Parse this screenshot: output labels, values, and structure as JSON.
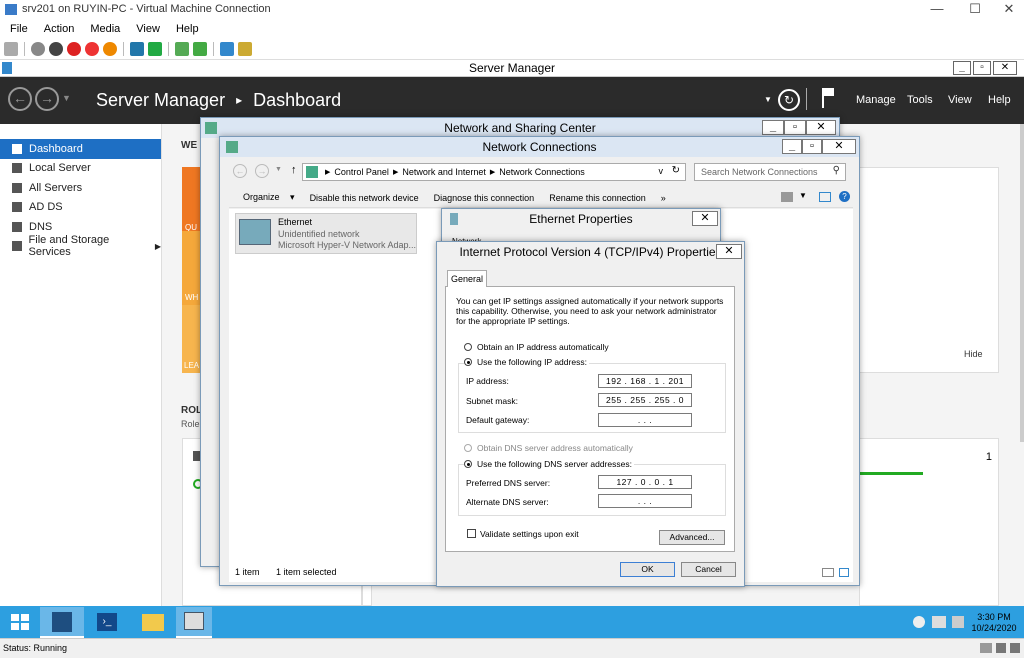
{
  "vm": {
    "title": "srv201 on RUYIN-PC - Virtual Machine Connection",
    "menu": [
      "File",
      "Action",
      "Media",
      "View",
      "Help"
    ],
    "status": "Status: Running"
  },
  "server_manager": {
    "window_title": "Server Manager",
    "header": "Server Manager",
    "breadcrumb": "Dashboard",
    "menu": [
      "Manage",
      "Tools",
      "View",
      "Help"
    ],
    "sidebar": [
      "Dashboard",
      "Local Server",
      "All Servers",
      "AD DS",
      "DNS",
      "File and Storage Services"
    ],
    "welcome_fragment": "WE",
    "tile_labels": [
      "QU",
      "WH",
      "LEA"
    ],
    "hide": "Hide",
    "roles_fragment": "ROL",
    "roles_sub_fragment": "Role",
    "count": "1"
  },
  "nsc": {
    "title": "Network and Sharing Center"
  },
  "nc": {
    "title": "Network Connections",
    "address": [
      "Control Panel",
      "Network and Internet",
      "Network Connections"
    ],
    "search_placeholder": "Search Network Connections",
    "commands": [
      "Organize",
      "Disable this network device",
      "Diagnose this connection",
      "Rename this connection",
      "»"
    ],
    "adapter": {
      "name": "Ethernet",
      "status": "Unidentified network",
      "device": "Microsoft Hyper-V Network Adap..."
    },
    "status_items": "1 item",
    "status_selected": "1 item selected"
  },
  "eth": {
    "title": "Ethernet Properties",
    "tab_fragment": "Network"
  },
  "ipv4": {
    "title": "Internet Protocol Version 4 (TCP/IPv4) Properties",
    "tab": "General",
    "description": "You can get IP settings assigned automatically if your network supports this capability. Otherwise, you need to ask your network administrator for the appropriate IP settings.",
    "auto_ip": "Obtain an IP address automatically",
    "manual_ip": "Use the following IP address:",
    "ip_label": "IP address:",
    "ip_value": "192 . 168 .   1  . 201",
    "mask_label": "Subnet mask:",
    "mask_value": "255 . 255 . 255 .   0",
    "gw_label": "Default gateway:",
    "gw_value": ".       .       .",
    "auto_dns": "Obtain DNS server address automatically",
    "manual_dns": "Use the following DNS server addresses:",
    "pdns_label": "Preferred DNS server:",
    "pdns_value": "127 .   0  .   0  .   1",
    "adns_label": "Alternate DNS server:",
    "adns_value": ".       .       .",
    "validate": "Validate settings upon exit",
    "advanced": "Advanced...",
    "ok": "OK",
    "cancel": "Cancel"
  },
  "tray": {
    "time": "3:30 PM",
    "date": "10/24/2020"
  }
}
